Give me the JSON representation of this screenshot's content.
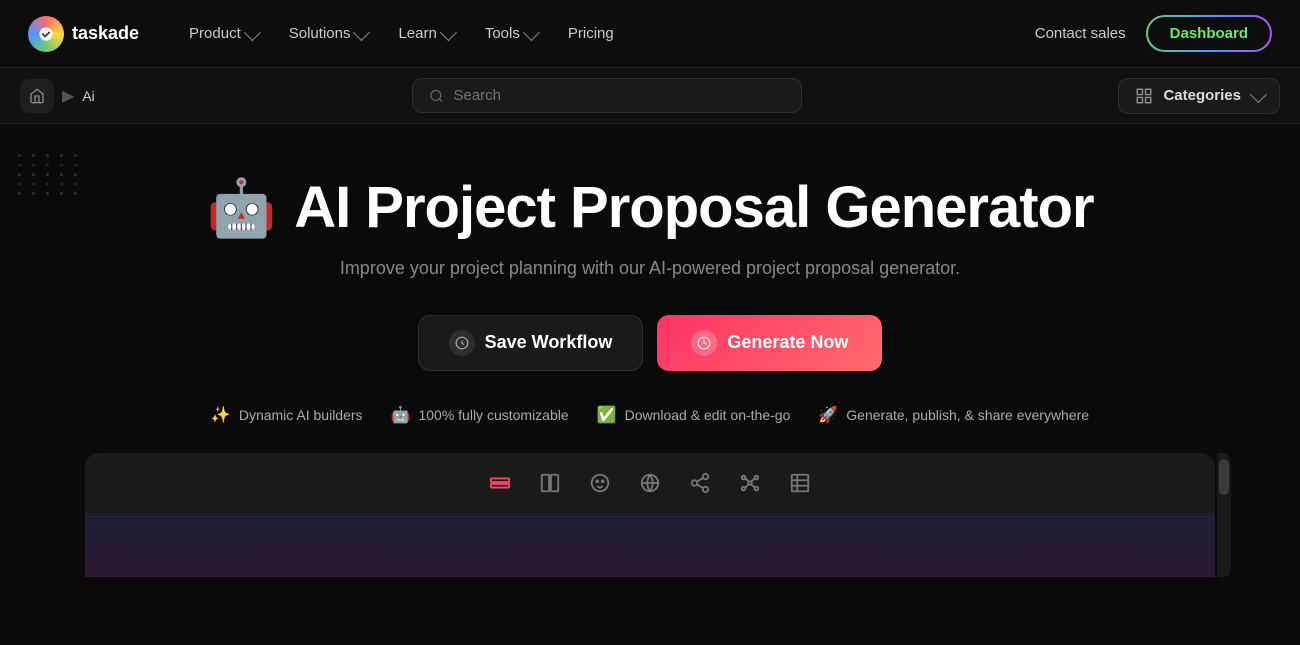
{
  "nav": {
    "logo_text": "taskade",
    "links": [
      {
        "label": "Product",
        "id": "product",
        "has_dropdown": true
      },
      {
        "label": "Solutions",
        "id": "solutions",
        "has_dropdown": true
      },
      {
        "label": "Learn",
        "id": "learn",
        "has_dropdown": true
      },
      {
        "label": "Tools",
        "id": "tools",
        "has_dropdown": true
      },
      {
        "label": "Pricing",
        "id": "pricing",
        "has_dropdown": false
      }
    ],
    "contact_sales": "Contact sales",
    "dashboard": "Dashboard"
  },
  "breadcrumb": {
    "home_icon": "⌂",
    "separator": "▶",
    "current": "Ai"
  },
  "search": {
    "placeholder": "Search",
    "icon": "🔍"
  },
  "categories": {
    "label": "Categories",
    "icon": "⊞"
  },
  "hero": {
    "emoji": "🤖",
    "title": "AI Project Proposal Generator",
    "subtitle": "Improve your project planning with our AI-powered project proposal generator.",
    "save_btn": "Save Workflow",
    "generate_btn": "Generate Now"
  },
  "features": [
    {
      "icon": "✨",
      "text": "Dynamic AI builders"
    },
    {
      "icon": "🤖",
      "text": "100% fully customizable"
    },
    {
      "icon": "✅",
      "text": "Download & edit on-the-go"
    },
    {
      "icon": "🚀",
      "text": "Generate, publish, & share everywhere"
    }
  ],
  "toolbar_icons": [
    {
      "id": "layers",
      "symbol": "▬▬",
      "active": true
    },
    {
      "id": "columns",
      "symbol": "⊟",
      "active": false
    },
    {
      "id": "face",
      "symbol": "☺",
      "active": false
    },
    {
      "id": "globe",
      "symbol": "⊕",
      "active": false
    },
    {
      "id": "share",
      "symbol": "⊗",
      "active": false
    },
    {
      "id": "nodes",
      "symbol": "⋮⋮",
      "active": false
    },
    {
      "id": "table",
      "symbol": "⊟",
      "active": false
    }
  ]
}
